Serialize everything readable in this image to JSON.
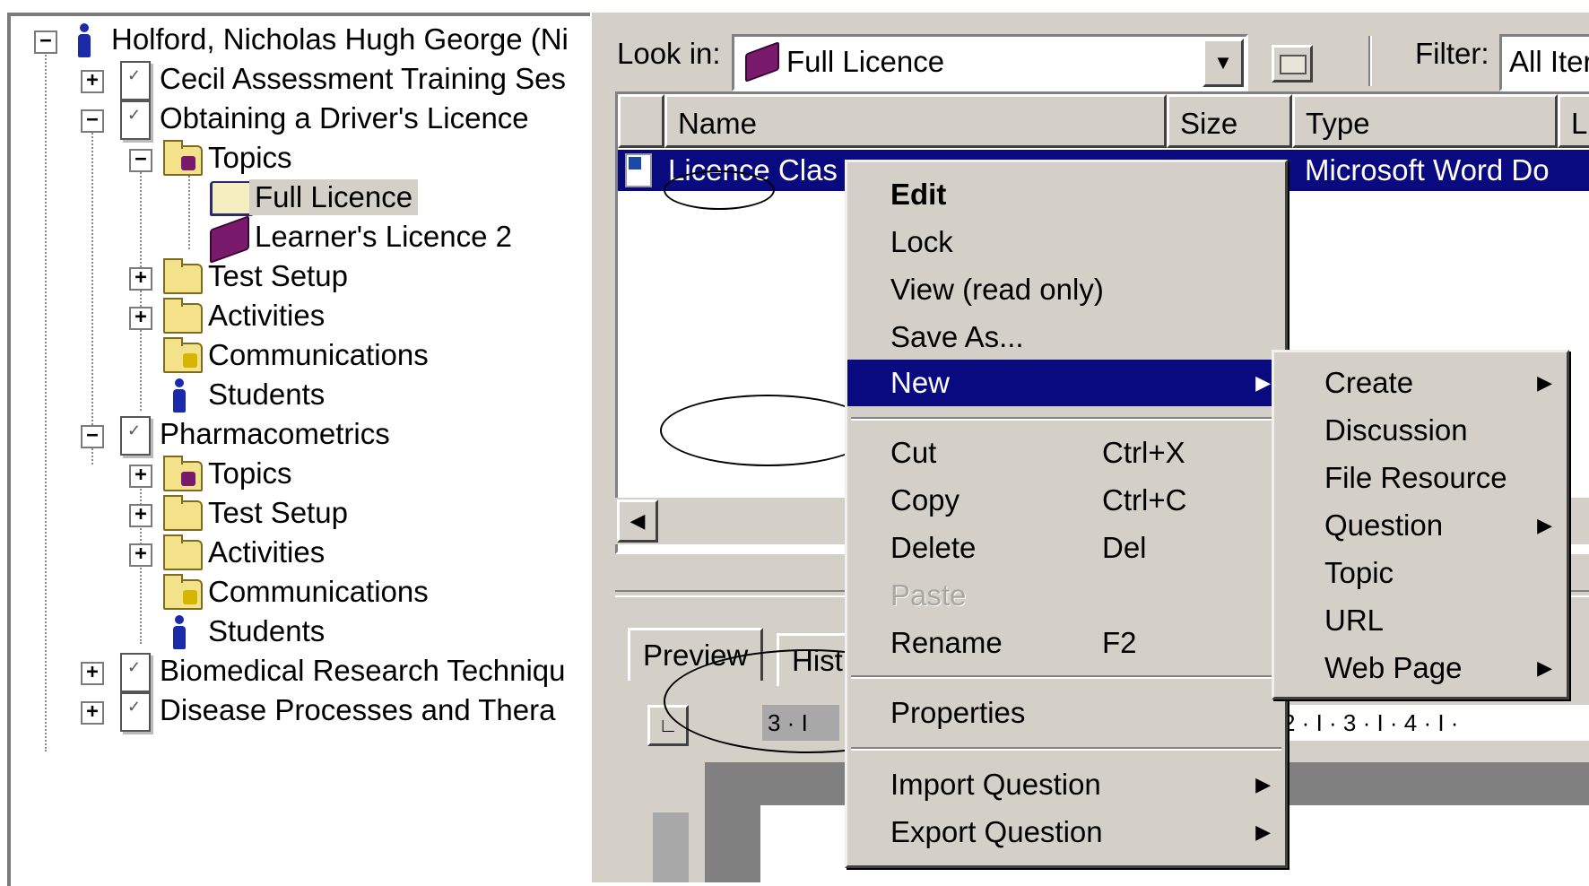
{
  "tree": {
    "root": "Holford, Nicholas Hugh George (Ni",
    "courses": [
      {
        "label": "Cecil Assessment Training Ses"
      },
      {
        "label": "Obtaining a Driver's Licence",
        "children": {
          "topics": "Topics",
          "topic_items": [
            "Full Licence",
            "Learner's Licence 2"
          ],
          "test_setup": "Test Setup",
          "activities": "Activities",
          "communications": "Communications",
          "students": "Students"
        }
      },
      {
        "label": "Pharmacometrics",
        "children": {
          "topics": "Topics",
          "test_setup": "Test Setup",
          "activities": "Activities",
          "communications": "Communications",
          "students": "Students"
        }
      },
      {
        "label": "Biomedical Research Techniqu"
      },
      {
        "label": "Disease Processes and Thera"
      }
    ]
  },
  "toolbar": {
    "look_in_label": "Look in:",
    "look_in_value": "Full Licence",
    "filter_label": "Filter:",
    "filter_value": "All Iter"
  },
  "file_list": {
    "columns": [
      "Name",
      "Size",
      "Type",
      "L"
    ],
    "rows": [
      {
        "name": "Licence Clas",
        "type": "Microsoft Word Do"
      }
    ]
  },
  "preview": {
    "tabs": [
      "Preview",
      "Hist"
    ],
    "ruler_left": "3 · I",
    "ruler_right": "2 · I · 3 · I · 4 · I ·"
  },
  "context_menu": {
    "items": [
      {
        "label": "Edit",
        "bold": true
      },
      {
        "label": "Lock"
      },
      {
        "label": "View (read only)"
      },
      {
        "label": "Save As..."
      },
      {
        "label": "New",
        "submenu": true,
        "highlighted": true
      },
      {
        "label": "Cut",
        "shortcut": "Ctrl+X"
      },
      {
        "label": "Copy",
        "shortcut": "Ctrl+C"
      },
      {
        "label": "Delete",
        "shortcut": "Del"
      },
      {
        "label": "Paste",
        "disabled": true
      },
      {
        "label": "Rename",
        "shortcut": "F2"
      },
      {
        "label": "Properties"
      },
      {
        "label": "Import Question",
        "submenu": true
      },
      {
        "label": "Export Question",
        "submenu": true
      }
    ]
  },
  "new_submenu": {
    "items": [
      {
        "label": "Create",
        "submenu": true
      },
      {
        "label": "Discussion"
      },
      {
        "label": "File Resource"
      },
      {
        "label": "Question",
        "submenu": true
      },
      {
        "label": "Topic"
      },
      {
        "label": "URL"
      },
      {
        "label": "Web Page",
        "submenu": true
      }
    ]
  },
  "colors": {
    "selection": "#0a0a80",
    "chrome": "#d4d0c8",
    "book": "#7a1a6c",
    "folder": "#f3e28a",
    "person": "#1a2aa8"
  },
  "icons": {
    "submenu_arrow": "▶",
    "dropdown_arrow": "▼",
    "scroll_left": "◀"
  }
}
